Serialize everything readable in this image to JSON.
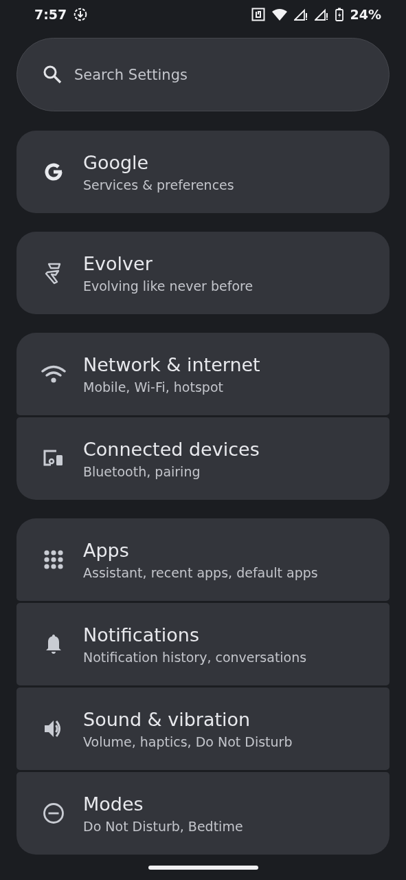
{
  "status_bar": {
    "time": "7:57",
    "battery": "24%"
  },
  "search": {
    "placeholder": "Search Settings"
  },
  "groups": [
    {
      "items": [
        {
          "kind": "google",
          "title": "Google",
          "subtitle": "Services & preferences"
        }
      ]
    },
    {
      "items": [
        {
          "kind": "evolver",
          "title": "Evolver",
          "subtitle": "Evolving like never before"
        }
      ]
    },
    {
      "items": [
        {
          "kind": "wifi",
          "title": "Network & internet",
          "subtitle": "Mobile, Wi-Fi, hotspot"
        },
        {
          "kind": "devices",
          "title": "Connected devices",
          "subtitle": "Bluetooth, pairing"
        }
      ]
    },
    {
      "items": [
        {
          "kind": "apps",
          "title": "Apps",
          "subtitle": "Assistant, recent apps, default apps"
        },
        {
          "kind": "bell",
          "title": "Notifications",
          "subtitle": "Notification history, conversations"
        },
        {
          "kind": "sound",
          "title": "Sound & vibration",
          "subtitle": "Volume, haptics, Do Not Disturb"
        },
        {
          "kind": "modes",
          "title": "Modes",
          "subtitle": "Do Not Disturb, Bedtime"
        }
      ]
    }
  ]
}
